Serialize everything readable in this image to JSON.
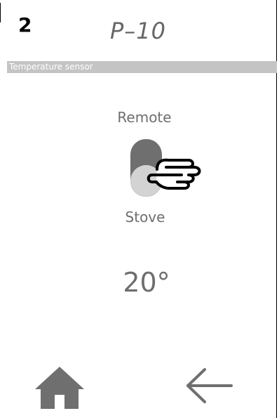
{
  "header": {
    "step_number": "2",
    "page_code": "P–10"
  },
  "section": {
    "title": "Temperature sensor"
  },
  "sensor_toggle": {
    "option_top": "Remote",
    "option_bottom": "Stove",
    "selected": "Stove"
  },
  "temperature": {
    "value": "20°"
  },
  "nav": {
    "home_icon": "home-icon",
    "back_icon": "arrow-left-icon"
  },
  "colors": {
    "text_gray": "#6e6e6e",
    "section_bar": "#c4c4c4",
    "toggle_track": "#6f6f6f",
    "toggle_knob": "#d3d3d3"
  }
}
